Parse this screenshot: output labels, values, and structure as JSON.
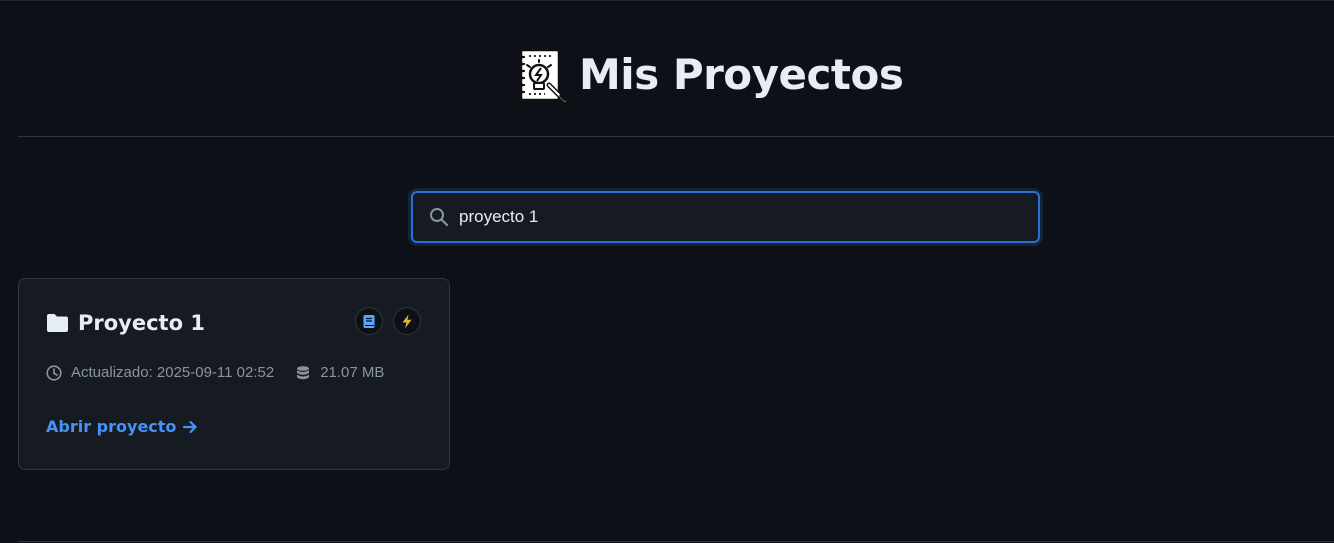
{
  "header": {
    "logo_icon": "lightbulb-notebook-icon",
    "title": "Mis Proyectos"
  },
  "search": {
    "icon": "search-icon",
    "value": "proyecto 1",
    "focus_color": "#2f6fd1"
  },
  "projects": [
    {
      "icon": "folder-icon",
      "title": "Proyecto 1",
      "badges": [
        "book-icon",
        "lightning-icon"
      ],
      "updated_label": "Actualizado: 2025-09-11 02:52",
      "size": "21.07 MB",
      "open_link": "Abrir proyecto"
    }
  ],
  "colors": {
    "background": "#0d1117",
    "card": "#161b22",
    "border": "#30363d",
    "link": "#4493f8",
    "muted": "#8b949e",
    "bolt": "#e3b341",
    "book": "#58a6ff"
  }
}
